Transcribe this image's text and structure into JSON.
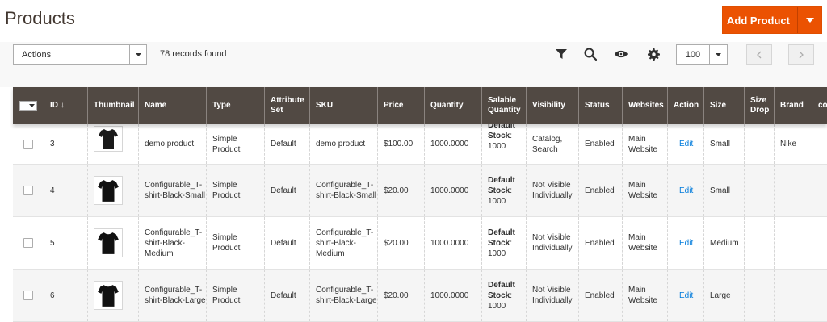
{
  "page": {
    "title": "Products"
  },
  "add_product": {
    "label": "Add Product"
  },
  "toolbar": {
    "actions_value": "Actions",
    "records_found": "78 records found",
    "per_page_value": "100",
    "icons": [
      "filter-icon",
      "search-icon",
      "eye-icon",
      "gear-icon"
    ]
  },
  "columns": [
    {
      "key": "id",
      "label": "ID ↓"
    },
    {
      "key": "thumbnail",
      "label": "Thumbnail"
    },
    {
      "key": "name",
      "label": "Name"
    },
    {
      "key": "type",
      "label": "Type"
    },
    {
      "key": "attribute_set",
      "label": "Attribute Set"
    },
    {
      "key": "sku",
      "label": "SKU"
    },
    {
      "key": "price",
      "label": "Price"
    },
    {
      "key": "quantity",
      "label": "Quantity"
    },
    {
      "key": "salable_quantity",
      "label": "Salable Quantity"
    },
    {
      "key": "visibility",
      "label": "Visibility"
    },
    {
      "key": "status",
      "label": "Status"
    },
    {
      "key": "websites",
      "label": "Websites"
    },
    {
      "key": "action",
      "label": "Action"
    },
    {
      "key": "size",
      "label": "Size"
    },
    {
      "key": "size_drop",
      "label": "Size Drop"
    },
    {
      "key": "brand",
      "label": "Brand"
    },
    {
      "key": "co",
      "label": "co"
    }
  ],
  "rows": [
    {
      "id": "3",
      "name": "demo product",
      "type": "Simple Product",
      "attribute_set": "Default",
      "sku": "demo product",
      "price": "$100.00",
      "quantity": "1000.0000",
      "stock_label": "Default Stock",
      "stock_value": "1000",
      "visibility": "Catalog, Search",
      "status": "Enabled",
      "websites": "Main Website",
      "action": "Edit",
      "size": "Small",
      "size_drop": "",
      "brand": "Nike"
    },
    {
      "id": "4",
      "name": "Configurable_T-shirt-Black-Small",
      "type": "Simple Product",
      "attribute_set": "Default",
      "sku": "Configurable_T-shirt-Black-Small",
      "price": "$20.00",
      "quantity": "1000.0000",
      "stock_label": "Default Stock",
      "stock_value": "1000",
      "visibility": "Not Visible Individually",
      "status": "Enabled",
      "websites": "Main Website",
      "action": "Edit",
      "size": "Small",
      "size_drop": "",
      "brand": ""
    },
    {
      "id": "5",
      "name": "Configurable_T-shirt-Black-Medium",
      "type": "Simple Product",
      "attribute_set": "Default",
      "sku": "Configurable_T-shirt-Black-Medium",
      "price": "$20.00",
      "quantity": "1000.0000",
      "stock_label": "Default Stock",
      "stock_value": "1000",
      "visibility": "Not Visible Individually",
      "status": "Enabled",
      "websites": "Main Website",
      "action": "Edit",
      "size": "Medium",
      "size_drop": "",
      "brand": ""
    },
    {
      "id": "6",
      "name": "Configurable_T-shirt-Black-Large",
      "type": "Simple Product",
      "attribute_set": "Default",
      "sku": "Configurable_T-shirt-Black-Large",
      "price": "$20.00",
      "quantity": "1000.0000",
      "stock_label": "Default Stock",
      "stock_value": "1000",
      "visibility": "Not Visible Individually",
      "status": "Enabled",
      "websites": "Main Website",
      "action": "Edit",
      "size": "Large",
      "size_drop": "",
      "brand": ""
    }
  ],
  "colors": {
    "accent": "#eb5202",
    "header_bg": "#514943",
    "link": "#007bdb"
  }
}
